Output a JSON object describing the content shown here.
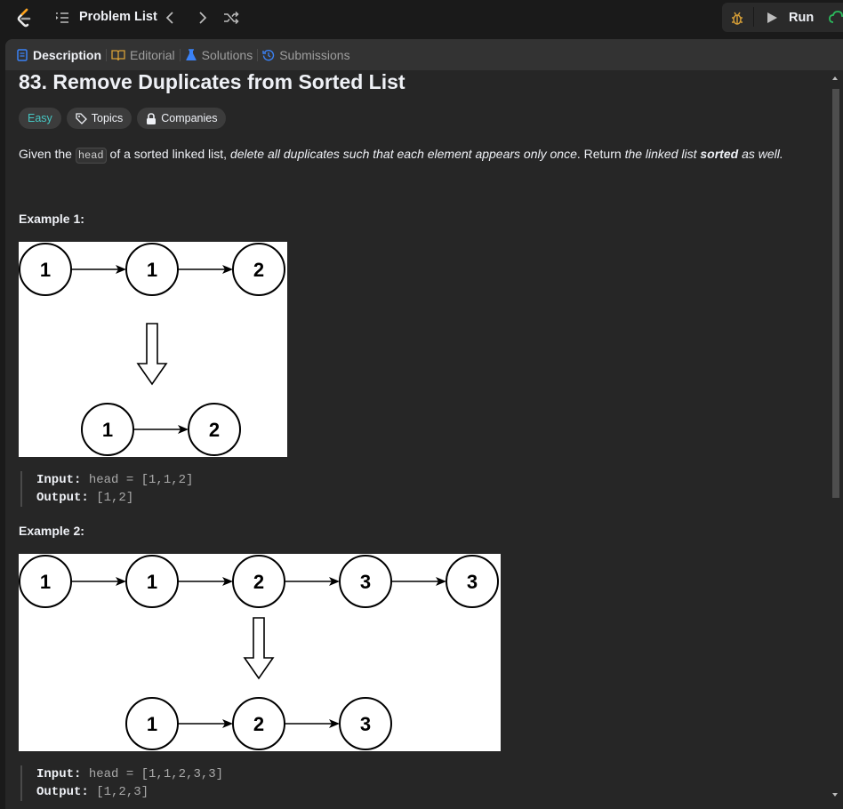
{
  "topbar": {
    "problem_list_label": "Problem List",
    "run_label": "Run"
  },
  "tabs": [
    {
      "label": "Description",
      "icon": "description-icon",
      "color": "#3b82f6"
    },
    {
      "label": "Editorial",
      "icon": "book-icon",
      "color": "#d8a037"
    },
    {
      "label": "Solutions",
      "icon": "flask-icon",
      "color": "#3b82f6"
    },
    {
      "label": "Submissions",
      "icon": "history-icon",
      "color": "#3b82f6"
    }
  ],
  "problem": {
    "title": "83. Remove Duplicates from Sorted List",
    "difficulty": "Easy",
    "topics_label": "Topics",
    "companies_label": "Companies",
    "desc_1": "Given the ",
    "desc_code": "head",
    "desc_2": " of a sorted linked list, ",
    "desc_3": "delete all duplicates such that each element appears only once",
    "desc_4": ". Return ",
    "desc_5": "the linked list ",
    "desc_6": "sorted",
    "desc_7": " as well."
  },
  "examples": [
    {
      "label": "Example 1:",
      "input_label": "Input:",
      "input_value": " head = [1,1,2]",
      "output_label": "Output:",
      "output_value": " [1,2]",
      "top_nodes": [
        "1",
        "1",
        "2"
      ],
      "bottom_nodes": [
        "1",
        "2"
      ]
    },
    {
      "label": "Example 2:",
      "input_label": "Input:",
      "input_value": " head = [1,1,2,3,3]",
      "output_label": "Output:",
      "output_value": " [1,2,3]",
      "top_nodes": [
        "1",
        "1",
        "2",
        "3",
        "3"
      ],
      "bottom_nodes": [
        "1",
        "2",
        "3"
      ]
    }
  ],
  "colors": {
    "accent_easy": "#46c6c2",
    "run_green": "#2cbb5d"
  }
}
